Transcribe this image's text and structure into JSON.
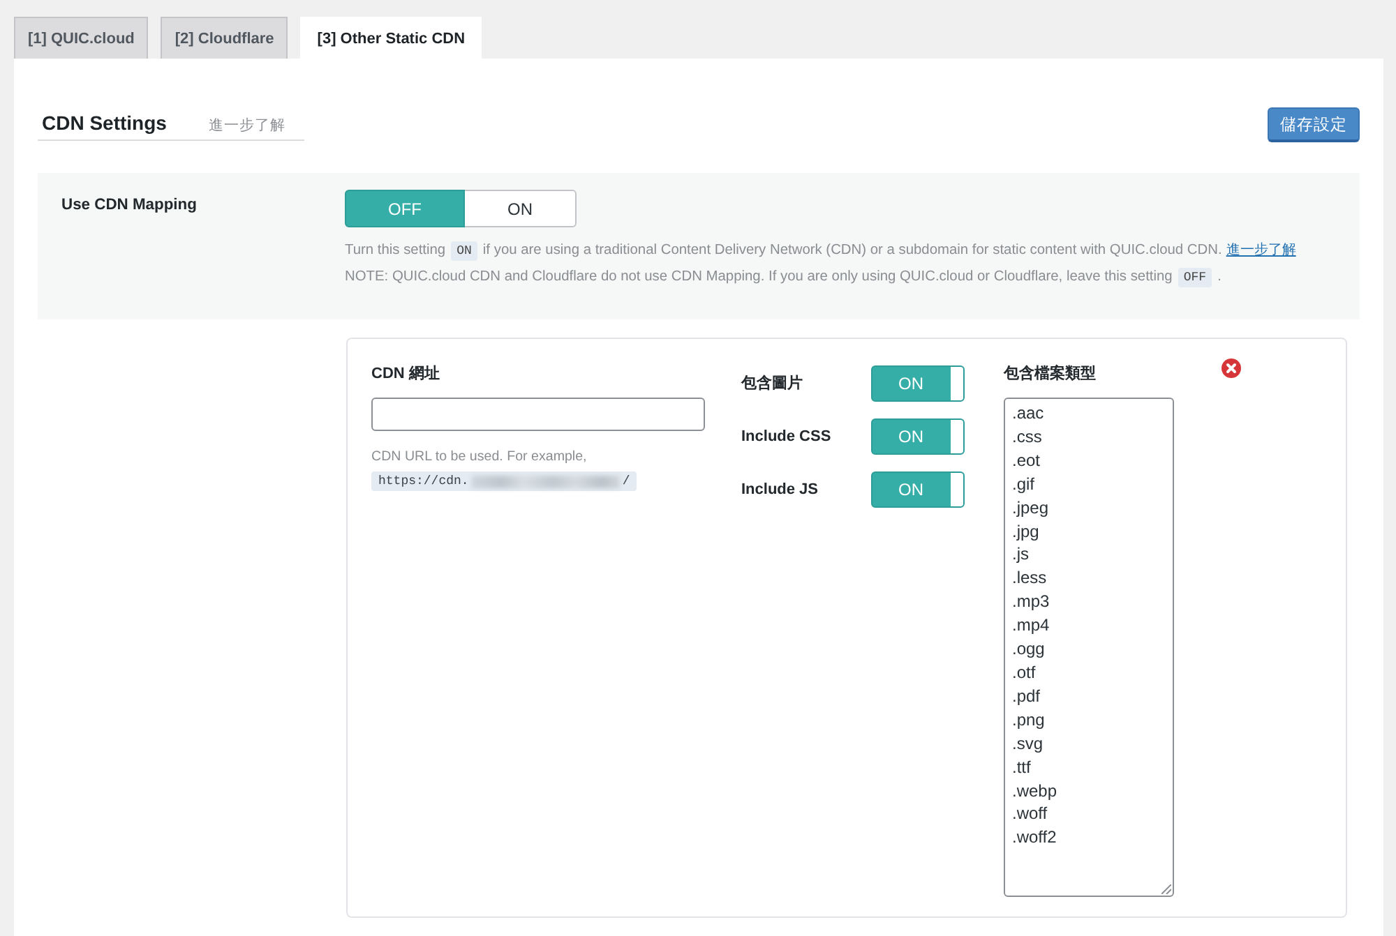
{
  "tabs": [
    {
      "label": "[1] QUIC.cloud",
      "selected": false
    },
    {
      "label": "[2] Cloudflare",
      "selected": false
    },
    {
      "label": "[3] Other Static CDN",
      "selected": true
    }
  ],
  "header": {
    "title": "CDN Settings",
    "learn_more": "進一步了解",
    "save_button": "儲存設定"
  },
  "cdn_mapping": {
    "label": "Use CDN Mapping",
    "options": [
      {
        "label": "OFF",
        "selected": true
      },
      {
        "label": "ON",
        "selected": false
      }
    ],
    "description": [
      {
        "parts": [
          {
            "kind": "text",
            "text": "Turn this setting"
          },
          {
            "kind": "code",
            "text": "ON"
          },
          {
            "kind": "text",
            "text": "if you are using a traditional Content Delivery Network (CDN) or a subdomain for static content with QUIC.cloud CDN."
          },
          {
            "kind": "link",
            "text": "進一步了解"
          }
        ]
      },
      {
        "parts": [
          {
            "kind": "text",
            "text": "NOTE: QUIC.cloud CDN and Cloudflare do not use CDN Mapping. If you are only using QUIC.cloud or Cloudflare, leave this setting"
          },
          {
            "kind": "code",
            "text": "OFF"
          },
          {
            "kind": "text",
            "text": "."
          }
        ]
      }
    ]
  },
  "mapping": {
    "url_field": {
      "label": "CDN 網址",
      "hint": "CDN URL to be used. For example,",
      "example_prefix": "https://cdn.",
      "example_suffix": "/"
    },
    "toggles": [
      {
        "label": "包含圖片",
        "on": true,
        "text": "ON"
      },
      {
        "label": "Include CSS",
        "on": true,
        "text": "ON"
      },
      {
        "label": "Include JS",
        "on": true,
        "text": "ON"
      }
    ],
    "file_types": {
      "label": "包含檔案類型",
      "values": [
        ".aac",
        ".css",
        ".eot",
        ".gif",
        ".jpeg",
        ".jpg",
        ".js",
        ".less",
        ".mp3",
        ".mp4",
        ".ogg",
        ".otf",
        ".pdf",
        ".png",
        ".svg",
        ".ttf",
        ".webp",
        ".woff",
        ".woff2"
      ]
    }
  }
}
